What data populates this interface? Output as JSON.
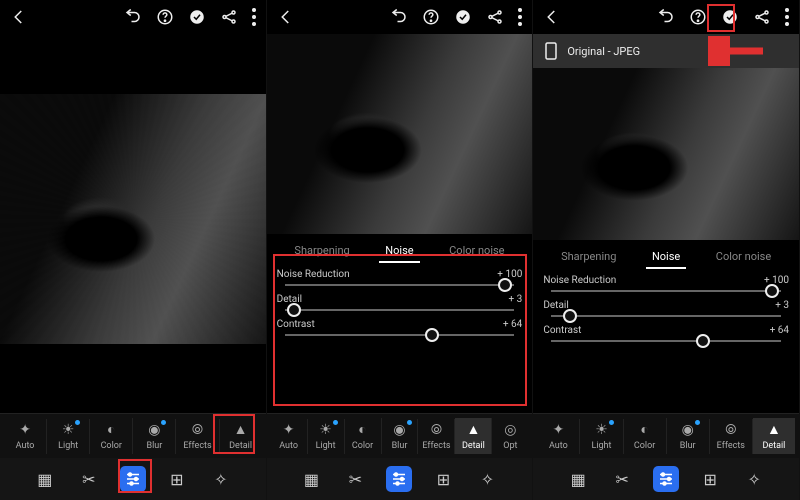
{
  "topbar_icons": [
    "back",
    "undo",
    "help",
    "apply",
    "share",
    "more"
  ],
  "tools": [
    {
      "label": "Auto",
      "icon": "auto"
    },
    {
      "label": "Light",
      "icon": "light",
      "dot": true
    },
    {
      "label": "Color",
      "icon": "color"
    },
    {
      "label": "Blur",
      "icon": "blur",
      "dot": true
    },
    {
      "label": "Effects",
      "icon": "effects"
    },
    {
      "label": "Detail",
      "icon": "detail"
    },
    {
      "label": "Opt",
      "icon": "optics"
    }
  ],
  "detail_tabs": [
    "Sharpening",
    "Noise",
    "Color noise"
  ],
  "active_tab": "Noise",
  "sliders": [
    {
      "name": "Noise Reduction",
      "value": "+ 100",
      "pos": 96
    },
    {
      "name": "Detail",
      "value": "+ 3",
      "pos": 4
    },
    {
      "name": "Contrast",
      "value": "+ 64",
      "pos": 64
    }
  ],
  "sliders3": [
    {
      "name": "Noise Reduction",
      "value": "+ 100",
      "pos": 96
    },
    {
      "name": "Detail",
      "value": "+ 3",
      "pos": 8
    },
    {
      "name": "Contrast",
      "value": "+ 64",
      "pos": 66
    }
  ],
  "original_banner": "Original - JPEG"
}
